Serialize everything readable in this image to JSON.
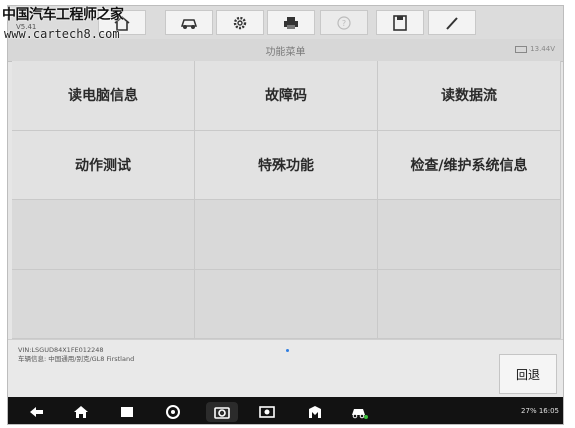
{
  "watermark": {
    "site_name": "中国汽车工程师之家",
    "url": "www.cartech8.com"
  },
  "app": {
    "version": "V5.41"
  },
  "toolbar": {
    "buttons": [
      {
        "icon": "car-icon"
      },
      {
        "icon": "settings-gear-icon"
      },
      {
        "icon": "printer-icon"
      },
      {
        "icon": "help-icon"
      },
      {
        "icon": "save-icon"
      },
      {
        "icon": "pen-icon"
      }
    ]
  },
  "header": {
    "title": "功能菜单",
    "voltage": "13.44V"
  },
  "menu": {
    "items": [
      {
        "label": "读电脑信息"
      },
      {
        "label": "故障码"
      },
      {
        "label": "读数据流"
      },
      {
        "label": "动作测试"
      },
      {
        "label": "特殊功能"
      },
      {
        "label": "检查/维护系统信息"
      }
    ]
  },
  "footer": {
    "vin": "VIN:LSGUD84X1FE012248",
    "vehicle_info": "车辆信息: 中国通用/别克/GL8 Firstland",
    "back_label": "回退"
  },
  "navbar": {
    "status": "27% 16:05"
  },
  "colors": {
    "accent": "#2f7de1",
    "nav_bg": "#121212"
  }
}
